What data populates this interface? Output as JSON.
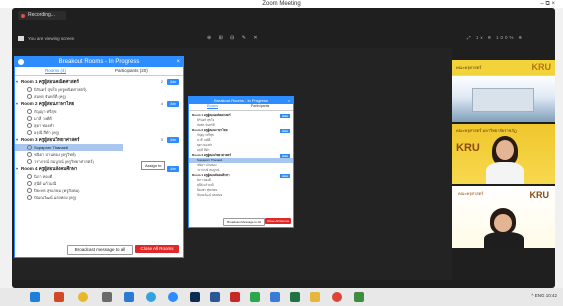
{
  "window": {
    "title": "Zoom Meeting",
    "controls": "– ⧉ ×"
  },
  "recording": {
    "label": "Recording..."
  },
  "share": {
    "title": "You are viewing screen",
    "tools": "⊕ ⊞ ⊟ ✎ ✕",
    "right": "⤢ 1x ⊖ 100% ⊕"
  },
  "breakout_main": {
    "title": "Breakout Rooms - In Progress",
    "close_x": "×",
    "tabs": [
      "Rooms (4)",
      "Participants (20)"
    ],
    "rooms": [
      {
        "name": "Room 1 ครูผู้สอนคณิตศาสตร์",
        "count": "2",
        "join": "Join",
        "members": [
          "นิรันดร์ สุขใจ (ครูคณิตศาสตร์)",
          "สมพร จันทร์ดี (ครู)"
        ]
      },
      {
        "name": "Room 2 ครูผู้สอนภาษาไทย",
        "count": "4",
        "join": "Join",
        "members": [
          "กัญญา ศรีสุข",
          "มาลี วงศ์ดี",
          "สุดา ทองคำ",
          "อรุณี สีดำ (ครู)"
        ]
      },
      {
        "name": "Room 3 ครูผู้สอนวิทยาศาสตร์",
        "count": "3",
        "join": "Join",
        "members": [
          "Supaporn Thanasit",
          "ชนิดา ปานทอง (ครูวิทย์)",
          "วราภรณ์ สมบูรณ์ (ครูวิทยาศาสตร์)"
        ]
      },
      {
        "name": "Room 4 ครูผู้สอนสังคมศึกษา",
        "count": "4",
        "join": "Join",
        "members": [
          "นิภา ทองดี",
          "สุนีย์ แก้วมณี",
          "ปิยะพร สุขเกษม (ครูสังคม)",
          "ปัณณวัฒน์ แสงทอง (ครู)"
        ]
      }
    ],
    "assign_label": "Assign to",
    "ask_all": "Broadcast message to all",
    "close_all": "Close All Rooms"
  },
  "breakout_second": {
    "title": "Breakout Rooms - In Progress",
    "close_x": "×",
    "tabs": [
      "Rooms",
      "Participants"
    ],
    "rooms": [
      {
        "name": "Room 1 ครูผู้สอนคณิตศาสตร์",
        "join": "Join",
        "members": [
          "นิรันดร์ สุขใจ",
          "สมพร จันทร์ดี"
        ]
      },
      {
        "name": "Room 2 ครูผู้สอนภาษาไทย",
        "join": "Join",
        "members": [
          "กัญญา ศรีสุข",
          "มาลี วงศ์ดี",
          "สุดา ทองคำ",
          "อรุณี สีดำ"
        ]
      },
      {
        "name": "Room 3 ครูผู้สอนวิทยาศาสตร์",
        "join": "Join",
        "members": [
          "Supaporn Thanasit",
          "ชนิดา ปานทอง",
          "วราภรณ์ สมบูรณ์"
        ]
      },
      {
        "name": "Room 4 ครูผู้สอนสังคมศึกษา",
        "join": "Join",
        "members": [
          "นิภา ทองดี",
          "สุนีย์ แก้วมณี",
          "ปิยะพร สุขเกษม",
          "ปัณณวัฒน์ แสงทอง"
        ]
      }
    ],
    "ask_all": "Broadcast Message to All",
    "close_all": "Close All Rooms"
  },
  "videos": [
    {
      "label": "KRU",
      "caption": "คณะครุศาสตร์"
    },
    {
      "label": "KRU",
      "caption": "คณะครุศาสตร์ มหาวิทยาลัยราชภัฏ"
    },
    {
      "label": "KRU",
      "caption": "คณะครุศาสตร์"
    }
  ],
  "taskbar": {
    "apps": [
      "start-icon",
      "powerpoint-icon",
      "chrome-icon",
      "files-icon",
      "store-icon",
      "edge-icon",
      "zoom-icon",
      "photoshop-icon",
      "word-icon",
      "acrobat-icon",
      "line-icon",
      "explorer-icon",
      "excel-icon",
      "folder-icon",
      "chrome-icon",
      "media-icon"
    ],
    "tray": "^ ENG 10:42"
  },
  "colors": {
    "accent": "#2d8cff",
    "danger": "#e02828",
    "highlight": "#a9c6ef"
  }
}
